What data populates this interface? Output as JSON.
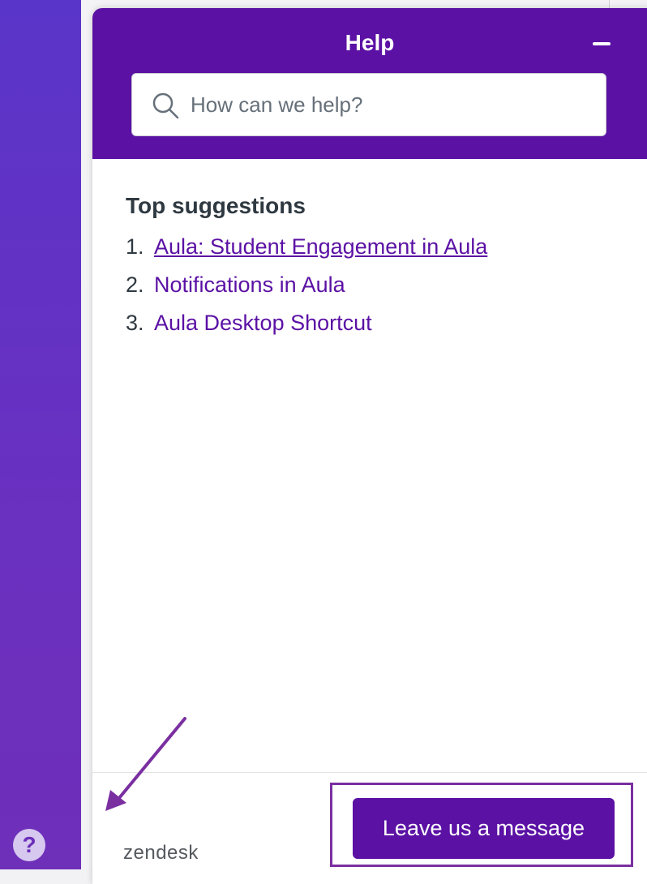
{
  "widget": {
    "title": "Help",
    "search": {
      "placeholder": "How can we help?",
      "value": ""
    },
    "suggestions_title": "Top suggestions",
    "suggestions": [
      {
        "number": "1.",
        "label": "Aula: Student Engagement in Aula"
      },
      {
        "number": "2.",
        "label": "Notifications in Aula"
      },
      {
        "number": "3.",
        "label": "Aula Desktop Shortcut"
      }
    ],
    "footer": {
      "brand": "zendesk",
      "button_label": "Leave us a message"
    }
  },
  "launcher": {
    "glyph": "?"
  },
  "colors": {
    "header": "#5b11a4",
    "accent": "#5b11a4",
    "sidebar": "#5f33c4",
    "annotation": "#7a2fa0"
  },
  "icons": [
    "search-icon",
    "minimize-icon",
    "help-icon",
    "arrow-annotation"
  ]
}
